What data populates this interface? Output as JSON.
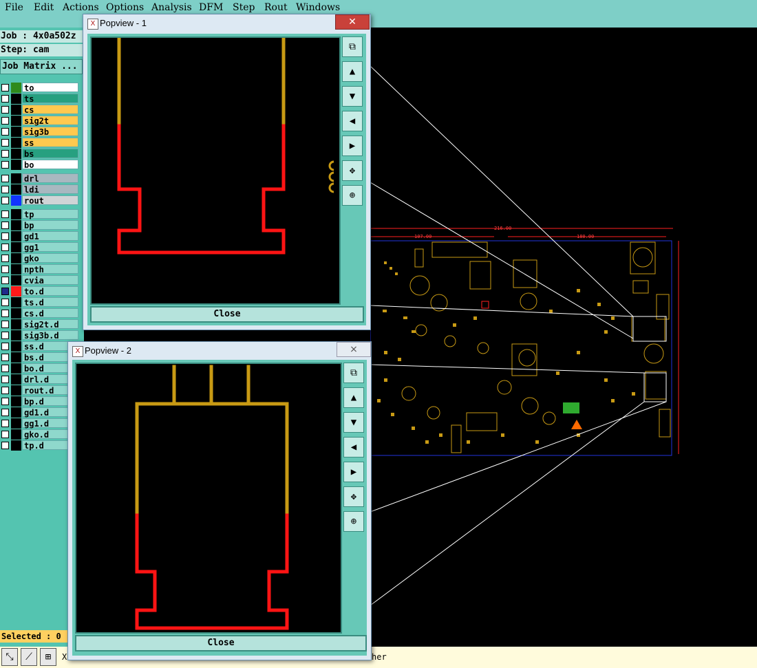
{
  "menu": [
    "File",
    "Edit",
    "Actions",
    "Options",
    "Analysis",
    "DFM",
    "Step",
    "Rout",
    "Windows"
  ],
  "job": {
    "job_label": "Job : 4x0a502z",
    "step_label": "Step: cam",
    "matrix_button": "Job Matrix ..."
  },
  "layers": [
    {
      "name": "to",
      "color": "#2f8a1c",
      "bg": "#ffffff"
    },
    {
      "name": "ts",
      "color": "#000000",
      "bg": "#27a080"
    },
    {
      "name": "cs",
      "color": "#000000",
      "bg": "#ffc94f"
    },
    {
      "name": "sig2t",
      "color": "#000000",
      "bg": "#ffc94f"
    },
    {
      "name": "sig3b",
      "color": "#000000",
      "bg": "#ffc94f"
    },
    {
      "name": "ss",
      "color": "#000000",
      "bg": "#ffc94f"
    },
    {
      "name": "bs",
      "color": "#000000",
      "bg": "#27a080"
    },
    {
      "name": "bo",
      "color": "#000000",
      "bg": "#ffffff"
    },
    {
      "name": "drl",
      "color": "#000000",
      "bg": "#a8b8c0"
    },
    {
      "name": "ldi",
      "color": "#000000",
      "bg": "#a8b8c0"
    },
    {
      "name": "rout",
      "color": "#1234ff",
      "bg": "#d0d4d6"
    },
    {
      "name": "tp",
      "color": "#000000",
      "bg": "#8fd8cc"
    },
    {
      "name": "bp",
      "color": "#000000",
      "bg": "#8fd8cc"
    },
    {
      "name": "gd1",
      "color": "#000000",
      "bg": "#8fd8cc"
    },
    {
      "name": "gg1",
      "color": "#000000",
      "bg": "#8fd8cc"
    },
    {
      "name": "gko",
      "color": "#000000",
      "bg": "#8fd8cc"
    },
    {
      "name": "npth",
      "color": "#000000",
      "bg": "#8fd8cc"
    },
    {
      "name": "cvia",
      "color": "#000000",
      "bg": "#8fd8cc"
    },
    {
      "name": "to.d",
      "color": "#ff1a1a",
      "bg": "#8fd8cc"
    },
    {
      "name": "ts.d",
      "color": "#000000",
      "bg": "#8fd8cc"
    },
    {
      "name": "cs.d",
      "color": "#000000",
      "bg": "#8fd8cc"
    },
    {
      "name": "sig2t.d",
      "color": "#000000",
      "bg": "#8fd8cc"
    },
    {
      "name": "sig3b.d",
      "color": "#000000",
      "bg": "#8fd8cc"
    },
    {
      "name": "ss.d",
      "color": "#000000",
      "bg": "#8fd8cc"
    },
    {
      "name": "bs.d",
      "color": "#000000",
      "bg": "#8fd8cc"
    },
    {
      "name": "bo.d",
      "color": "#000000",
      "bg": "#8fd8cc"
    },
    {
      "name": "drl.d",
      "color": "#000000",
      "bg": "#8fd8cc"
    },
    {
      "name": "rout.d",
      "color": "#000000",
      "bg": "#8fd8cc"
    },
    {
      "name": "bp.d",
      "color": "#000000",
      "bg": "#8fd8cc"
    },
    {
      "name": "gd1.d",
      "color": "#000000",
      "bg": "#8fd8cc"
    },
    {
      "name": "gg1.d",
      "color": "#000000",
      "bg": "#8fd8cc"
    },
    {
      "name": "gko.d",
      "color": "#000000",
      "bg": "#8fd8cc"
    },
    {
      "name": "tp.d",
      "color": "#000000",
      "bg": "#8fd8cc"
    }
  ],
  "status": {
    "selected": "Selected : 0"
  },
  "bottom": {
    "left_text": "X",
    "right_text": "her"
  },
  "popups": [
    {
      "title": "Popview - 1",
      "close_label": "Close",
      "close_icon": "✕"
    },
    {
      "title": "Popview - 2",
      "close_label": "Close",
      "close_icon": "⨯"
    }
  ],
  "board_dims": [
    "216.00",
    "107.00",
    "180.00"
  ],
  "colors": {
    "trace_gold": "#c89a14",
    "trace_red": "#ff1414",
    "panel_teal": "#54c4b0",
    "menubar": "#7ecfc7"
  }
}
